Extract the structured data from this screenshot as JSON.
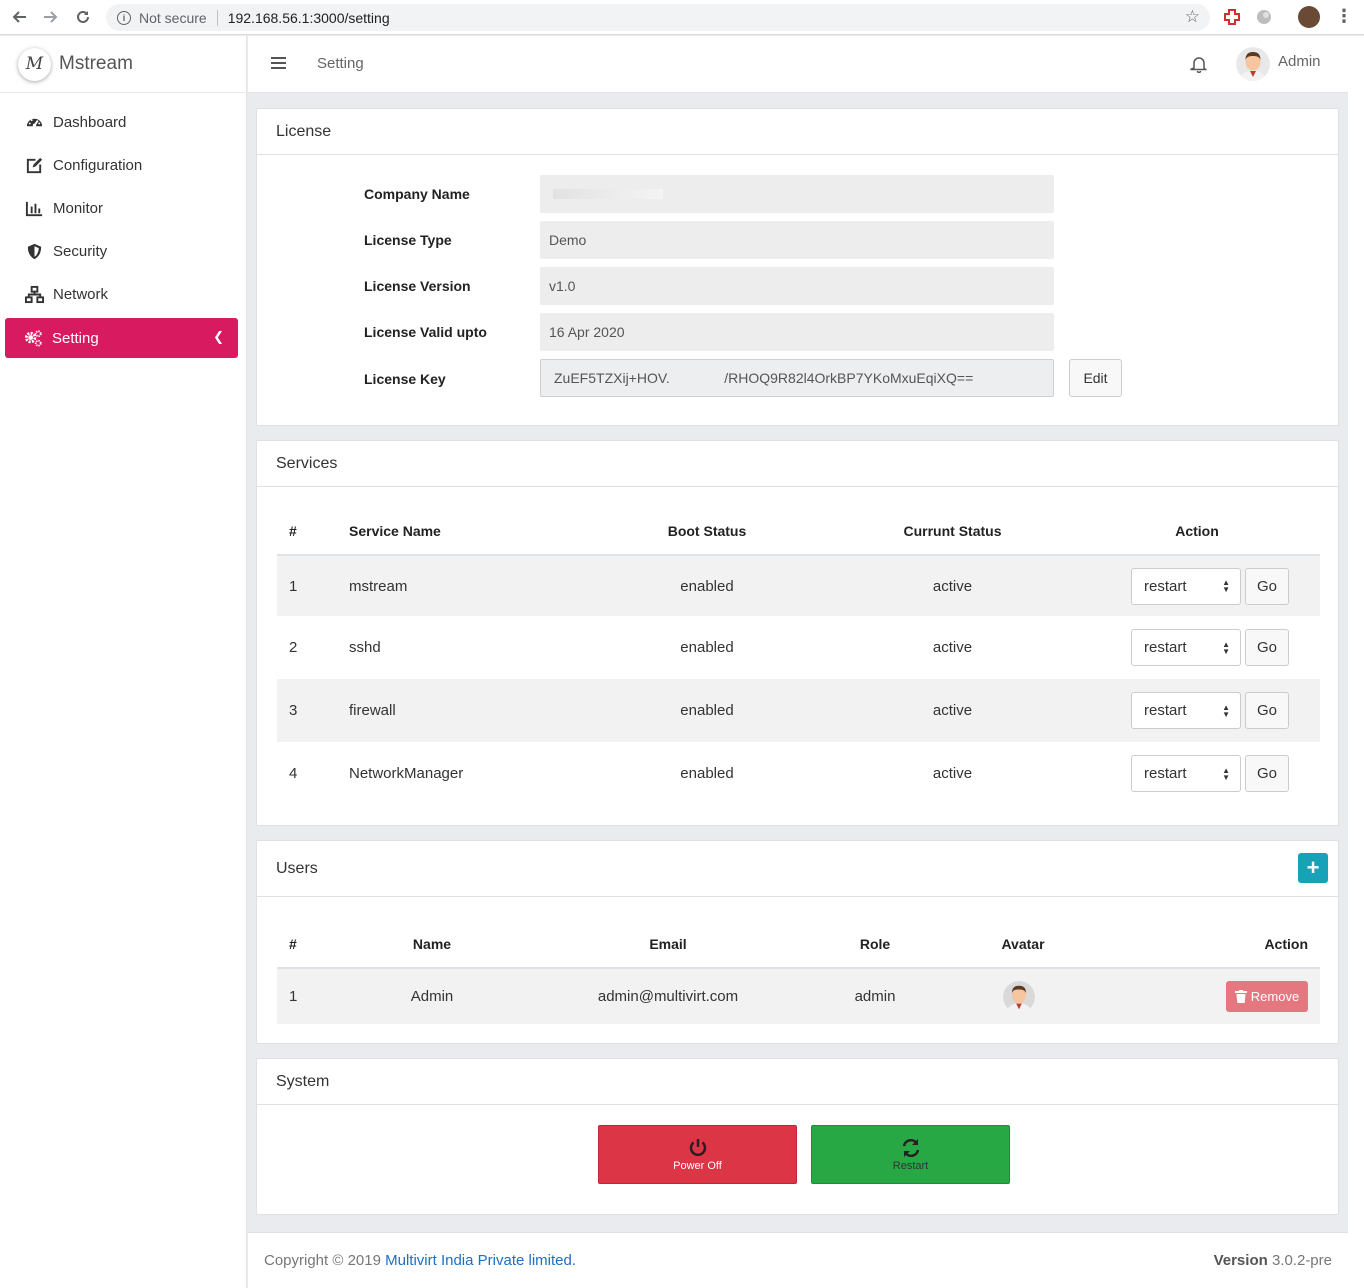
{
  "browser": {
    "security_label": "Not secure",
    "url": "192.168.56.1:3000/setting"
  },
  "brand": {
    "logo_letter": "M",
    "name": "Mstream"
  },
  "sidebar": {
    "items": [
      {
        "label": "Dashboard",
        "icon": "tachometer-icon"
      },
      {
        "label": "Configuration",
        "icon": "edit-icon"
      },
      {
        "label": "Monitor",
        "icon": "bar-chart-icon"
      },
      {
        "label": "Security",
        "icon": "shield-icon"
      },
      {
        "label": "Network",
        "icon": "network-icon"
      },
      {
        "label": "Setting",
        "icon": "gears-icon",
        "active": true
      }
    ]
  },
  "header": {
    "breadcrumb": "Setting",
    "user_name": "Admin"
  },
  "license": {
    "title": "License",
    "fields": [
      {
        "label": "Company Name",
        "value": ""
      },
      {
        "label": "License Type",
        "value": "Demo"
      },
      {
        "label": "License Version",
        "value": "v1.0"
      },
      {
        "label": "License Valid upto",
        "value": "16 Apr 2020"
      },
      {
        "label": "License Key",
        "value": "ZuEF5TZXij+HOV.              /RHOQ9R82l4OrkBP7YKoMxuEqiXQ=="
      }
    ],
    "edit_label": "Edit"
  },
  "services": {
    "title": "Services",
    "columns": [
      "#",
      "Service Name",
      "Boot Status",
      "Currunt Status",
      "Action"
    ],
    "rows": [
      {
        "num": "1",
        "name": "mstream",
        "boot": "enabled",
        "status": "active",
        "action": "restart"
      },
      {
        "num": "2",
        "name": "sshd",
        "boot": "enabled",
        "status": "active",
        "action": "restart"
      },
      {
        "num": "3",
        "name": "firewall",
        "boot": "enabled",
        "status": "active",
        "action": "restart"
      },
      {
        "num": "4",
        "name": "NetworkManager",
        "boot": "enabled",
        "status": "active",
        "action": "restart"
      }
    ],
    "go_label": "Go"
  },
  "users": {
    "title": "Users",
    "add_label": "+",
    "columns": [
      "#",
      "Name",
      "Email",
      "Role",
      "Avatar",
      "Action"
    ],
    "rows": [
      {
        "num": "1",
        "name": "Admin",
        "email": "admin@multivirt.com",
        "role": "admin"
      }
    ],
    "remove_label": "Remove"
  },
  "system": {
    "title": "System",
    "power_off_label": "Power Off",
    "restart_label": "Restart"
  },
  "footer": {
    "copyright_prefix": "Copyright © 2019",
    "company": "Multivirt India Private limited.",
    "version_label": "Version",
    "version": "3.0.2-pre"
  },
  "colors": {
    "active_menu": "#d81b60",
    "status_green": "#28a745",
    "add_button": "#17a2b8",
    "power_off": "#dc3545",
    "restart": "#28a745",
    "remove": "#e4777f"
  }
}
